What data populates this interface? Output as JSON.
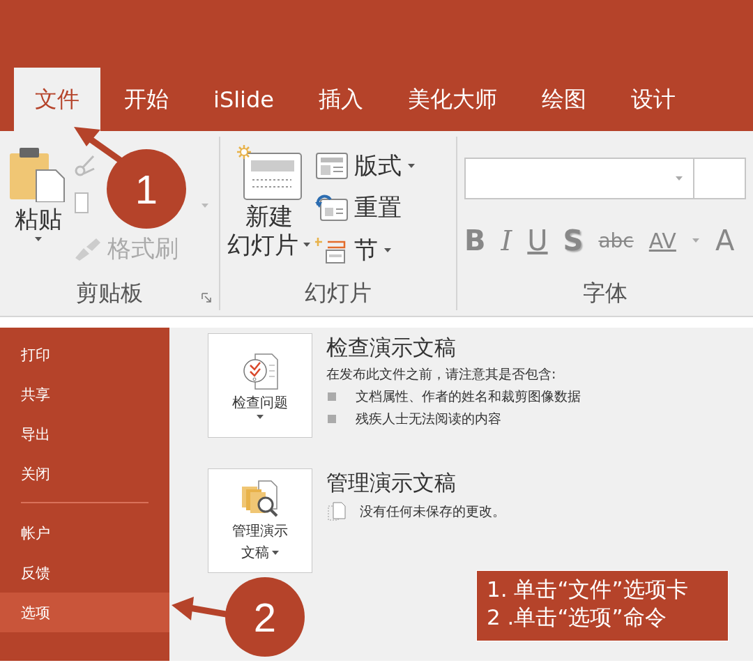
{
  "tabs": [
    {
      "label": "文件",
      "selected": true
    },
    {
      "label": "开始",
      "selected": false
    },
    {
      "label": "iSlide",
      "selected": false
    },
    {
      "label": "插入",
      "selected": false
    },
    {
      "label": "美化大师",
      "selected": false
    },
    {
      "label": "绘图",
      "selected": false
    },
    {
      "label": "设计",
      "selected": false
    }
  ],
  "ribbon": {
    "clipboard": {
      "paste": "粘贴",
      "format_painter": "格式刷",
      "label": "剪贴板"
    },
    "slides": {
      "new_slide": [
        "新建",
        "幻灯片"
      ],
      "layout": "版式",
      "reset": "重置",
      "section": "节",
      "label": "幻灯片"
    },
    "font": {
      "buttons": [
        "B",
        "I",
        "U",
        "S",
        "abc",
        "AV",
        "A"
      ],
      "label": "字体"
    }
  },
  "sidebar": {
    "items": [
      {
        "label": "打印",
        "selected": false
      },
      {
        "label": "共享",
        "selected": false
      },
      {
        "label": "导出",
        "selected": false
      },
      {
        "label": "关闭",
        "selected": false
      },
      {
        "kind": "divider"
      },
      {
        "label": "帐户",
        "selected": false
      },
      {
        "label": "反馈",
        "selected": false
      },
      {
        "label": "选项",
        "selected": true
      }
    ]
  },
  "sections": [
    {
      "kind": "inspect",
      "button": [
        "检查问题"
      ],
      "title": "检查演示文稿",
      "description": "在发布此文件之前，请注意其是否包含:",
      "bullets": [
        "文档属性、作者的姓名和裁剪图像数据",
        "残疾人士无法阅读的内容"
      ]
    },
    {
      "kind": "manage",
      "button": [
        "管理演示",
        "文稿"
      ],
      "title": "管理演示文稿",
      "note": "没有任何未保存的更改。"
    }
  ],
  "callouts": [
    "1",
    "2"
  ],
  "instructions": [
    "1. 单击“文件”选项卡",
    "2 .单击“选项”命令"
  ]
}
